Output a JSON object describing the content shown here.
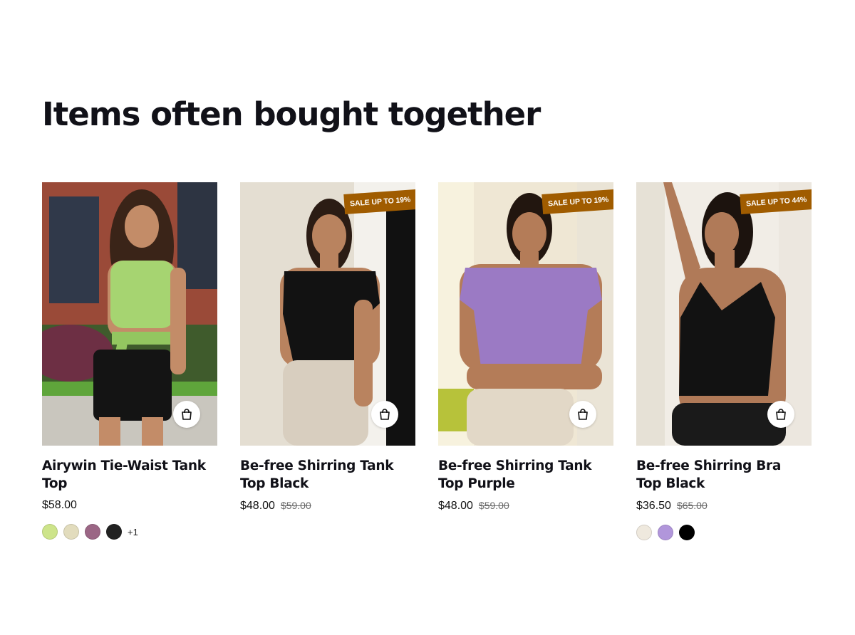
{
  "section": {
    "title": "Items often bought together"
  },
  "products": [
    {
      "name": "Airywin Tie-Waist Tank Top",
      "price": "$58.00",
      "old_price": "",
      "sale_badge": "",
      "swatches": [
        "#cde48a",
        "#e2dcbd",
        "#9b6685",
        "#222222"
      ],
      "more_swatches": "+1",
      "icon": "shopping-bag-icon"
    },
    {
      "name": "Be-free Shirring Tank Top Black",
      "price": "$48.00",
      "old_price": "$59.00",
      "sale_badge": "SALE UP TO 19%",
      "swatches": [],
      "more_swatches": "",
      "icon": "shopping-bag-icon"
    },
    {
      "name": "Be-free Shirring Tank Top Purple",
      "price": "$48.00",
      "old_price": "$59.00",
      "sale_badge": "SALE UP TO 19%",
      "swatches": [],
      "more_swatches": "",
      "icon": "shopping-bag-icon"
    },
    {
      "name": "Be-free Shirring Bra Top Black",
      "price": "$36.50",
      "old_price": "$65.00",
      "sale_badge": "SALE UP TO 44%",
      "swatches": [
        "#efe9de",
        "#b196db",
        "#000000"
      ],
      "more_swatches": "",
      "icon": "shopping-bag-icon"
    }
  ],
  "colors": {
    "badge_background": "#a05c00",
    "badge_text": "#ffffff",
    "heading_text": "#111118",
    "old_price_text": "#666666"
  }
}
